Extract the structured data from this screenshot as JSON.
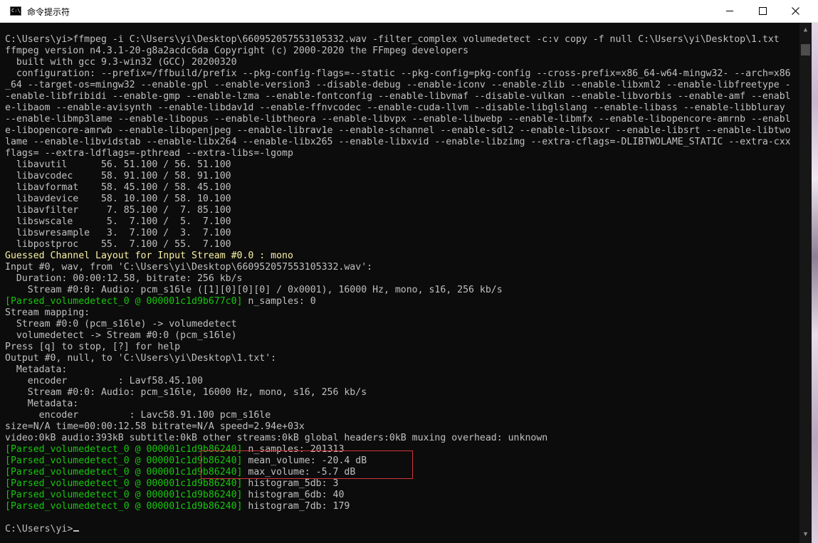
{
  "window": {
    "title": "命令提示符",
    "icon_label": "C:\\",
    "icon": "cmd-icon",
    "controls": [
      "minimize-icon",
      "maximize-icon",
      "close-icon"
    ]
  },
  "colors": {
    "background": "#0c0c0c",
    "text": "#c0c0c0",
    "warning": "#f9f1a5",
    "filter_prefix": "#16c60c",
    "highlight_box": "#d13438"
  },
  "console": {
    "lines": [
      {
        "text": "C:\\Users\\yi>ffmpeg -i C:\\Users\\yi\\Desktop\\660952057553105332.wav -filter_complex volumedetect -c:v copy -f null C:\\Users\\yi\\Desktop\\1.txt"
      },
      {
        "text": "ffmpeg version n4.3.1-20-g8a2acdc6da Copyright (c) 2000-2020 the FFmpeg developers"
      },
      {
        "text": "  built with gcc 9.3-win32 (GCC) 20200320"
      },
      {
        "text": "  configuration: --prefix=/ffbuild/prefix --pkg-config-flags=--static --pkg-config=pkg-config --cross-prefix=x86_64-w64-mingw32- --arch=x86"
      },
      {
        "text": "_64 --target-os=mingw32 --enable-gpl --enable-version3 --disable-debug --enable-iconv --enable-zlib --enable-libxml2 --enable-libfreetype -"
      },
      {
        "text": "-enable-libfribidi --enable-gmp --enable-lzma --enable-fontconfig --enable-libvmaf --disable-vulkan --enable-libvorbis --enable-amf --enabl"
      },
      {
        "text": "e-libaom --enable-avisynth --enable-libdav1d --enable-ffnvcodec --enable-cuda-llvm --disable-libglslang --enable-libass --enable-libbluray"
      },
      {
        "text": "--enable-libmp3lame --enable-libopus --enable-libtheora --enable-libvpx --enable-libwebp --enable-libmfx --enable-libopencore-amrnb --enabl"
      },
      {
        "text": "e-libopencore-amrwb --enable-libopenjpeg --enable-librav1e --enable-schannel --enable-sdl2 --enable-libsoxr --enable-libsrt --enable-libtwo"
      },
      {
        "text": "lame --enable-libvidstab --enable-libx264 --enable-libx265 --enable-libxvid --enable-libzimg --extra-cflags=-DLIBTWOLAME_STATIC --extra-cxx"
      },
      {
        "text": "flags= --extra-ldflags=-pthread --extra-libs=-lgomp"
      },
      {
        "text": "  libavutil      56. 51.100 / 56. 51.100"
      },
      {
        "text": "  libavcodec     58. 91.100 / 58. 91.100"
      },
      {
        "text": "  libavformat    58. 45.100 / 58. 45.100"
      },
      {
        "text": "  libavdevice    58. 10.100 / 58. 10.100"
      },
      {
        "text": "  libavfilter     7. 85.100 /  7. 85.100"
      },
      {
        "text": "  libswscale      5.  7.100 /  5.  7.100"
      },
      {
        "text": "  libswresample   3.  7.100 /  3.  7.100"
      },
      {
        "text": "  libpostproc    55.  7.100 / 55.  7.100"
      },
      {
        "text": "Guessed Channel Layout for Input Stream #0.0 : mono",
        "style": "warning"
      },
      {
        "text": "Input #0, wav, from 'C:\\Users\\yi\\Desktop\\660952057553105332.wav':"
      },
      {
        "text": "  Duration: 00:00:12.58, bitrate: 256 kb/s"
      },
      {
        "text": "    Stream #0:0: Audio: pcm_s16le ([1][0][0][0] / 0x0001), 16000 Hz, mono, s16, 256 kb/s"
      },
      {
        "prefix": "[Parsed_volumedetect_0 @ 000001c1d9b677c0]",
        "text": " n_samples: 0"
      },
      {
        "text": "Stream mapping:"
      },
      {
        "text": "  Stream #0:0 (pcm_s16le) -> volumedetect"
      },
      {
        "text": "  volumedetect -> Stream #0:0 (pcm_s16le)"
      },
      {
        "text": "Press [q] to stop, [?] for help"
      },
      {
        "text": "Output #0, null, to 'C:\\Users\\yi\\Desktop\\1.txt':"
      },
      {
        "text": "  Metadata:"
      },
      {
        "text": "    encoder         : Lavf58.45.100"
      },
      {
        "text": "    Stream #0:0: Audio: pcm_s16le, 16000 Hz, mono, s16, 256 kb/s"
      },
      {
        "text": "    Metadata:"
      },
      {
        "text": "      encoder         : Lavc58.91.100 pcm_s16le"
      },
      {
        "text": "size=N/A time=00:00:12.58 bitrate=N/A speed=2.94e+03x"
      },
      {
        "text": "video:0kB audio:393kB subtitle:0kB other streams:0kB global headers:0kB muxing overhead: unknown"
      },
      {
        "prefix": "[Parsed_volumedetect_0 @ 000001c1d9b86240]",
        "text": " n_samples: 201313"
      },
      {
        "prefix": "[Parsed_volumedetect_0 @ 000001c1d9b86240]",
        "text": " mean_volume: -20.4 dB"
      },
      {
        "prefix": "[Parsed_volumedetect_0 @ 000001c1d9b86240]",
        "text": " max_volume: -5.7 dB"
      },
      {
        "prefix": "[Parsed_volumedetect_0 @ 000001c1d9b86240]",
        "text": " histogram_5db: 3"
      },
      {
        "prefix": "[Parsed_volumedetect_0 @ 000001c1d9b86240]",
        "text": " histogram_6db: 40"
      },
      {
        "prefix": "[Parsed_volumedetect_0 @ 000001c1d9b86240]",
        "text": " histogram_7db: 179"
      },
      {
        "text": ""
      },
      {
        "text": "C:\\Users\\yi>",
        "cursor": true
      }
    ]
  }
}
